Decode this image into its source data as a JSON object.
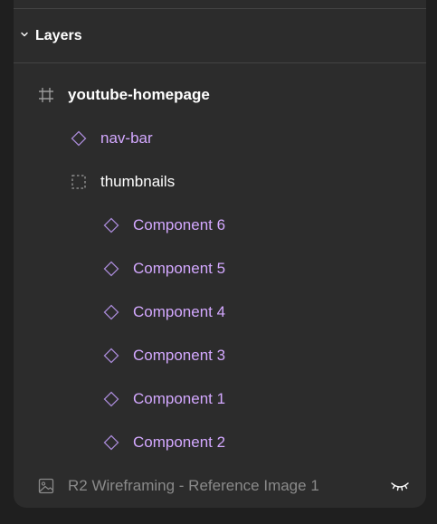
{
  "section": {
    "title": "Layers",
    "chevron_icon": "chevron-down-icon"
  },
  "layers": [
    {
      "label": "youtube-homepage",
      "type": "frame",
      "icon": "frame-hash-icon",
      "depth": 0
    },
    {
      "label": "nav-bar",
      "type": "component",
      "icon": "component-diamond-icon",
      "depth": 1
    },
    {
      "label": "thumbnails",
      "type": "group",
      "icon": "group-dashed-square-icon",
      "depth": 1
    },
    {
      "label": "Component 6",
      "type": "component",
      "icon": "component-diamond-icon",
      "depth": 2
    },
    {
      "label": "Component 5",
      "type": "component",
      "icon": "component-diamond-icon",
      "depth": 2
    },
    {
      "label": "Component 4",
      "type": "component",
      "icon": "component-diamond-icon",
      "depth": 2
    },
    {
      "label": "Component 3",
      "type": "component",
      "icon": "component-diamond-icon",
      "depth": 2
    },
    {
      "label": "Component 1",
      "type": "component",
      "icon": "component-diamond-icon",
      "depth": 2
    },
    {
      "label": "Component 2",
      "type": "component",
      "icon": "component-diamond-icon",
      "depth": 2
    },
    {
      "label": "R2 Wireframing - Reference Image 1",
      "type": "image",
      "icon": "image-icon",
      "depth": 0,
      "visibility_icon": "eye-closed-icon",
      "hidden": true
    }
  ],
  "colors": {
    "panel_background": "#2c2c2c",
    "page_background": "#1f1f1f",
    "component_text": "#d3a8ff",
    "hidden_text": "#8a8a8a",
    "divider": "#444444"
  }
}
